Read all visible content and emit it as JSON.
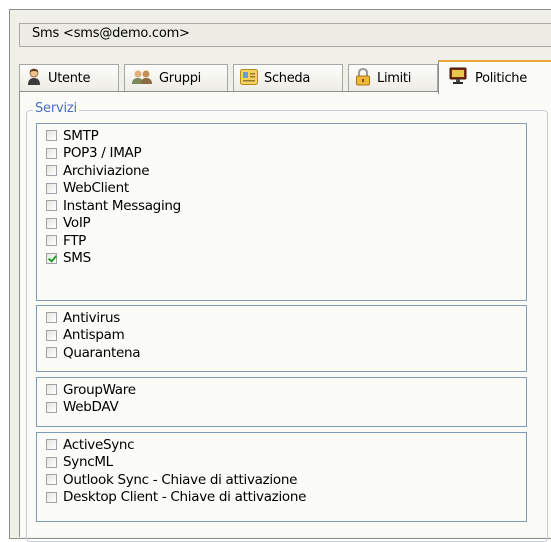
{
  "account": {
    "display": "Sms <sms@demo.com>"
  },
  "tabs": [
    {
      "label": "Utente",
      "icon": "user-icon"
    },
    {
      "label": "Gruppi",
      "icon": "group-icon"
    },
    {
      "label": "Scheda",
      "icon": "card-icon"
    },
    {
      "label": "Limiti",
      "icon": "lock-icon"
    },
    {
      "label": "Politiche",
      "icon": "monitor-icon",
      "active": true
    }
  ],
  "services": {
    "legend": "Servizi",
    "groups": [
      {
        "items": [
          {
            "label": "SMTP",
            "checked": false
          },
          {
            "label": "POP3 / IMAP",
            "checked": false
          },
          {
            "label": "Archiviazione",
            "checked": false
          },
          {
            "label": "WebClient",
            "checked": false
          },
          {
            "label": "Instant Messaging",
            "checked": false
          },
          {
            "label": "VoIP",
            "checked": false
          },
          {
            "label": "FTP",
            "checked": false
          },
          {
            "label": "SMS",
            "checked": true
          }
        ]
      },
      {
        "items": [
          {
            "label": "Antivirus",
            "checked": false
          },
          {
            "label": "Antispam",
            "checked": false
          },
          {
            "label": "Quarantena",
            "checked": false
          }
        ]
      },
      {
        "items": [
          {
            "label": "GroupWare",
            "checked": false
          },
          {
            "label": "WebDAV",
            "checked": false
          }
        ]
      },
      {
        "items": [
          {
            "label": "ActiveSync",
            "checked": false
          },
          {
            "label": "SyncML",
            "checked": false
          },
          {
            "label": "Outlook Sync - Chiave di attivazione",
            "checked": false
          },
          {
            "label": "Desktop Client - Chiave di attivazione",
            "checked": false
          }
        ]
      }
    ]
  },
  "colors": {
    "legend": "#4b6ec2",
    "group_border": "#7f9db9",
    "active_tab_accent": "#e8a53b",
    "check_mark": "#21a121"
  }
}
